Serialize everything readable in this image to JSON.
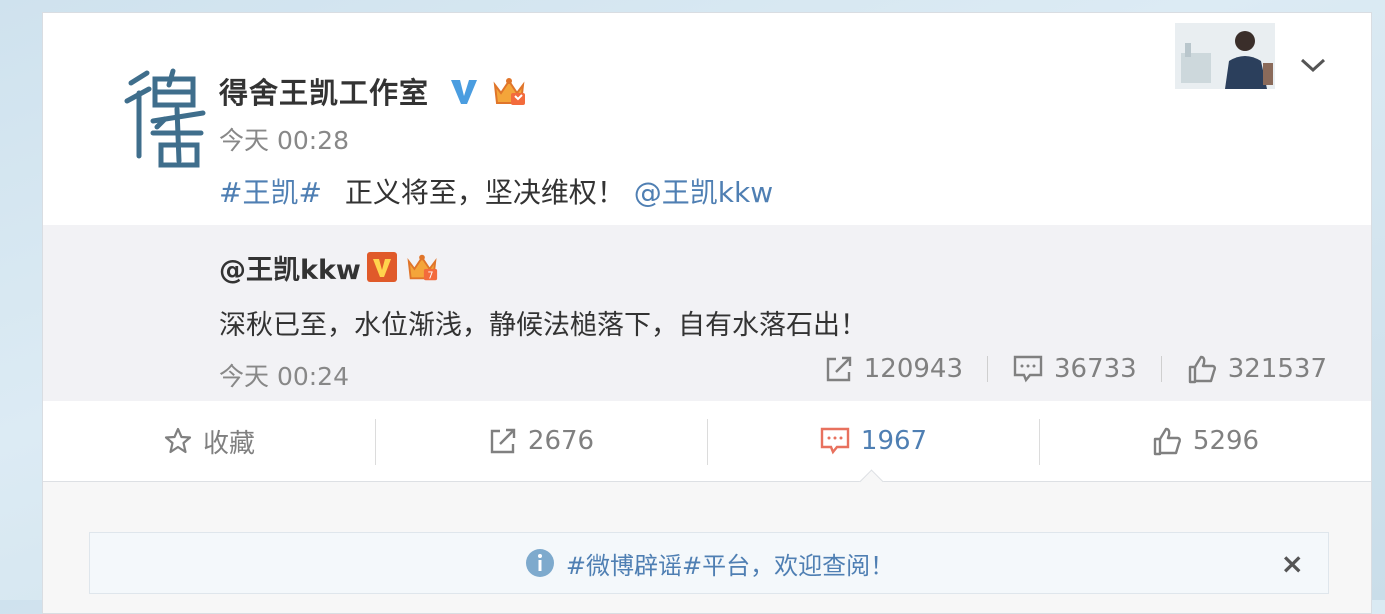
{
  "post": {
    "author": "得舍王凯工作室",
    "time": "今天 00:28",
    "hashtag": "#王凯#",
    "text": "正义将至，坚决维权！",
    "mention": "@王凯kkw"
  },
  "retweet": {
    "author": "@王凯kkw",
    "text": "深秋已至，水位渐浅，静候法槌落下，自有水落石出！",
    "time": "今天 00:24",
    "reposts": "120943",
    "comments": "36733",
    "likes": "321537"
  },
  "actions": {
    "favorite_label": "收藏",
    "repost_count": "2676",
    "comment_count": "1967",
    "like_count": "5296"
  },
  "notice": {
    "text": "#微博辟谣#平台，欢迎查阅！",
    "close": "×"
  },
  "colors": {
    "link": "#4f7fb3",
    "verified": "#4a9de0",
    "comment_active": "#e8715e"
  },
  "icons": [
    "avatar-logo",
    "verified-icon",
    "crown-badge-icon",
    "chevron-down-icon",
    "share-icon",
    "comment-icon",
    "like-icon",
    "star-icon",
    "info-icon",
    "close-icon"
  ]
}
